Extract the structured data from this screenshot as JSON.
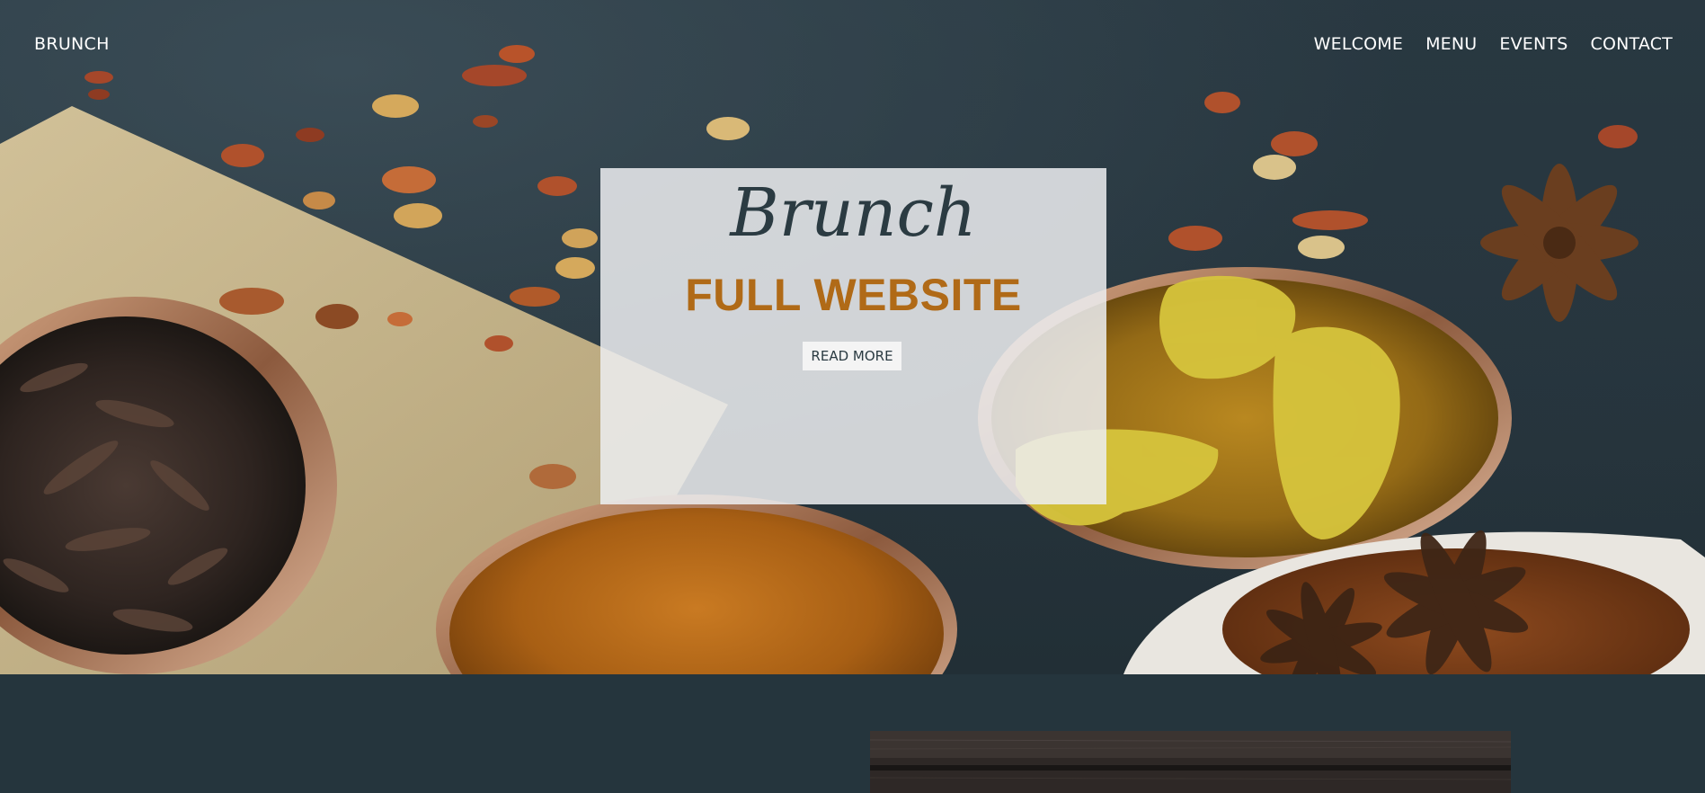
{
  "nav": {
    "brand": "BRUNCH",
    "items": [
      {
        "label": "WELCOME"
      },
      {
        "label": "MENU"
      },
      {
        "label": "EVENTS"
      },
      {
        "label": "CONTACT"
      }
    ]
  },
  "hero": {
    "script_title": "Brunch",
    "headline": "FULL WEBSITE",
    "cta_label": "READ MORE"
  },
  "colors": {
    "page_background": "#25353d",
    "headline": "#b06a17",
    "script_title": "#2b3b42",
    "card_background": "#eceef0",
    "nav_text": "#ffffff"
  },
  "icons": {
    "hero_image": "spices-photo",
    "lower_image": "wood-plank-photo"
  }
}
